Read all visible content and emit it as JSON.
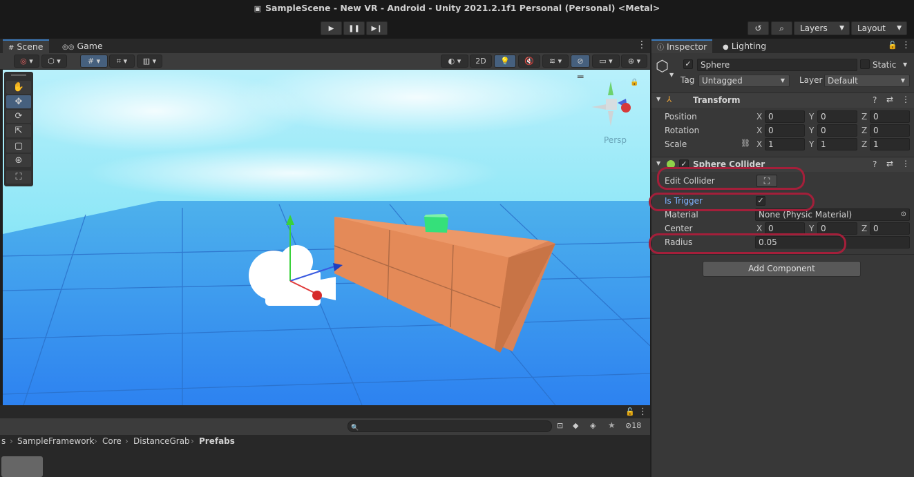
{
  "window": {
    "title": "SampleScene - New VR - Android - Unity 2021.2.1f1 Personal (Personal) <Metal>"
  },
  "toolbar": {
    "layers_label": "Layers",
    "layout_label": "Layout"
  },
  "scene_tabs": {
    "scene": "Scene",
    "game": "Game"
  },
  "scene_toolbar": {
    "mode_2d": "2D"
  },
  "viewport": {
    "persp_label": "Persp"
  },
  "inspector": {
    "tabs": {
      "inspector": "Inspector",
      "lighting": "Lighting"
    },
    "object": {
      "name": "Sphere",
      "static_label": "Static",
      "tag_label": "Tag",
      "tag_value": "Untagged",
      "layer_label": "Layer",
      "layer_value": "Default"
    },
    "transform": {
      "title": "Transform",
      "position": {
        "label": "Position",
        "x": "0",
        "y": "0",
        "z": "0"
      },
      "rotation": {
        "label": "Rotation",
        "x": "0",
        "y": "0",
        "z": "0"
      },
      "scale": {
        "label": "Scale",
        "x": "1",
        "y": "1",
        "z": "1"
      }
    },
    "sphere_collider": {
      "title": "Sphere Collider",
      "edit_collider_label": "Edit Collider",
      "is_trigger_label": "Is Trigger",
      "is_trigger": true,
      "material_label": "Material",
      "material_value": "None (Physic Material)",
      "center_label": "Center",
      "center": {
        "x": "0",
        "y": "0",
        "z": "0"
      },
      "radius_label": "Radius",
      "radius_value": "0.05"
    },
    "add_component": "Add Component",
    "axis": {
      "x": "X",
      "y": "Y",
      "z": "Z"
    }
  },
  "project": {
    "breadcrumbs": [
      "s",
      "SampleFramework",
      "Core",
      "DistanceGrab",
      "Prefabs"
    ],
    "hidden_count": "18"
  },
  "colors": {
    "highlight": "#a41f3a",
    "sky": "#7fe0f3",
    "floor": "#2f8ef0",
    "box": "#e48a58",
    "green_cube": "#35e07a",
    "is_trigger_label": "#7fb3ff"
  }
}
